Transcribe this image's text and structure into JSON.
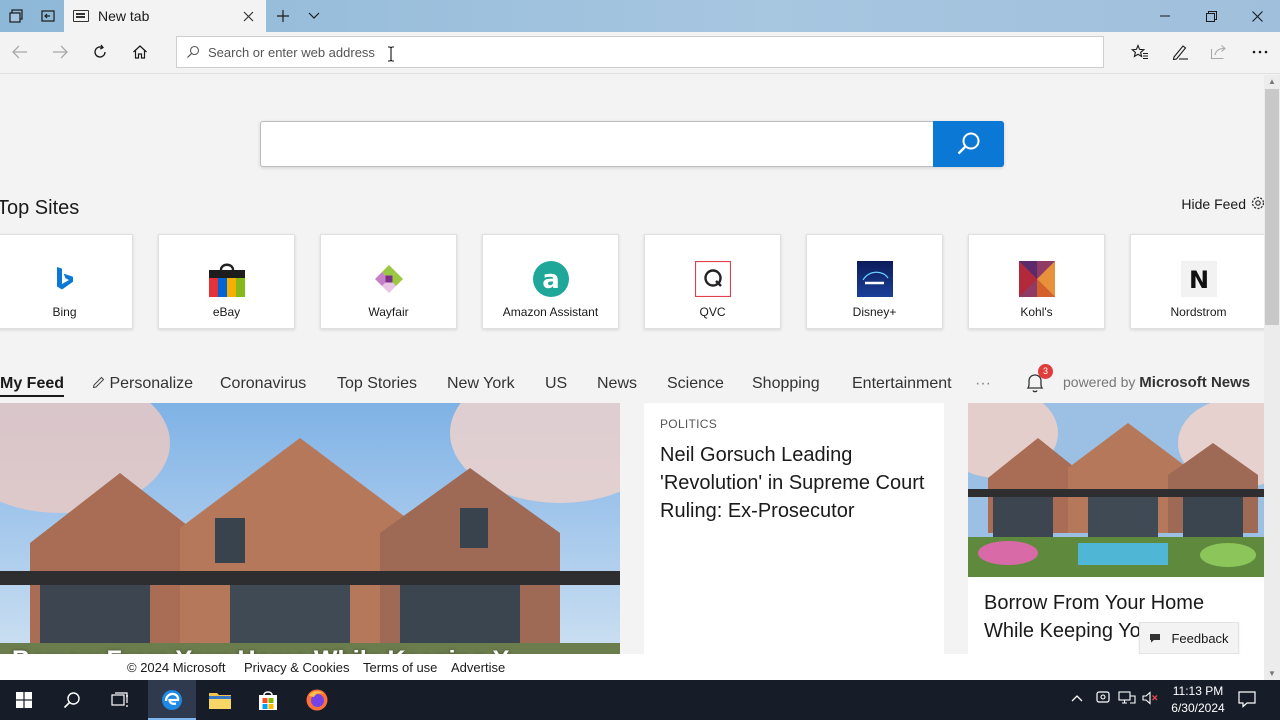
{
  "browser": {
    "tab_title": "New tab",
    "address_placeholder": "Search or enter web address"
  },
  "colors": {
    "accent": "#0a78d4",
    "taskbar": "#171d28",
    "badge": "#e03c3c"
  },
  "top_sites": {
    "title": "Top Sites",
    "hide_feed": "Hide Feed",
    "sites": [
      {
        "label": "Bing",
        "icon": "bing-logo"
      },
      {
        "label": "eBay",
        "icon": "ebay-bag-logo"
      },
      {
        "label": "Wayfair",
        "icon": "wayfair-logo"
      },
      {
        "label": "Amazon Assistant",
        "icon": "amazon-assistant-logo"
      },
      {
        "label": "QVC",
        "icon": "qvc-logo"
      },
      {
        "label": "Disney+",
        "icon": "disney-plus-logo"
      },
      {
        "label": "Kohl's",
        "icon": "kohls-logo"
      },
      {
        "label": "Nordstrom",
        "icon": "nordstrom-logo"
      }
    ]
  },
  "feed": {
    "tabs": [
      "My Feed",
      "Personalize",
      "Coronavirus",
      "Top Stories",
      "New York",
      "US",
      "News",
      "Science",
      "Shopping",
      "Entertainment"
    ],
    "more": "···",
    "notification_count": "3",
    "powered_by": "powered by",
    "powered_brand": "Microsoft News",
    "cards": {
      "main_headline": "Borrow From Your Home While Keeping Y",
      "text_category": "POLITICS",
      "text_headline": "Neil Gorsuch Leading 'Revolution' in Supreme Court Ruling: Ex-Prosecutor",
      "right_headline": "Borrow From Your Home While Keeping Yo"
    },
    "feedback": "Feedback"
  },
  "footer": {
    "copyright": "© 2024 Microsoft",
    "privacy": "Privacy & Cookies",
    "terms": "Terms of use",
    "advertise": "Advertise"
  },
  "taskbar": {
    "time": "11:13 PM",
    "date": "6/30/2024"
  }
}
